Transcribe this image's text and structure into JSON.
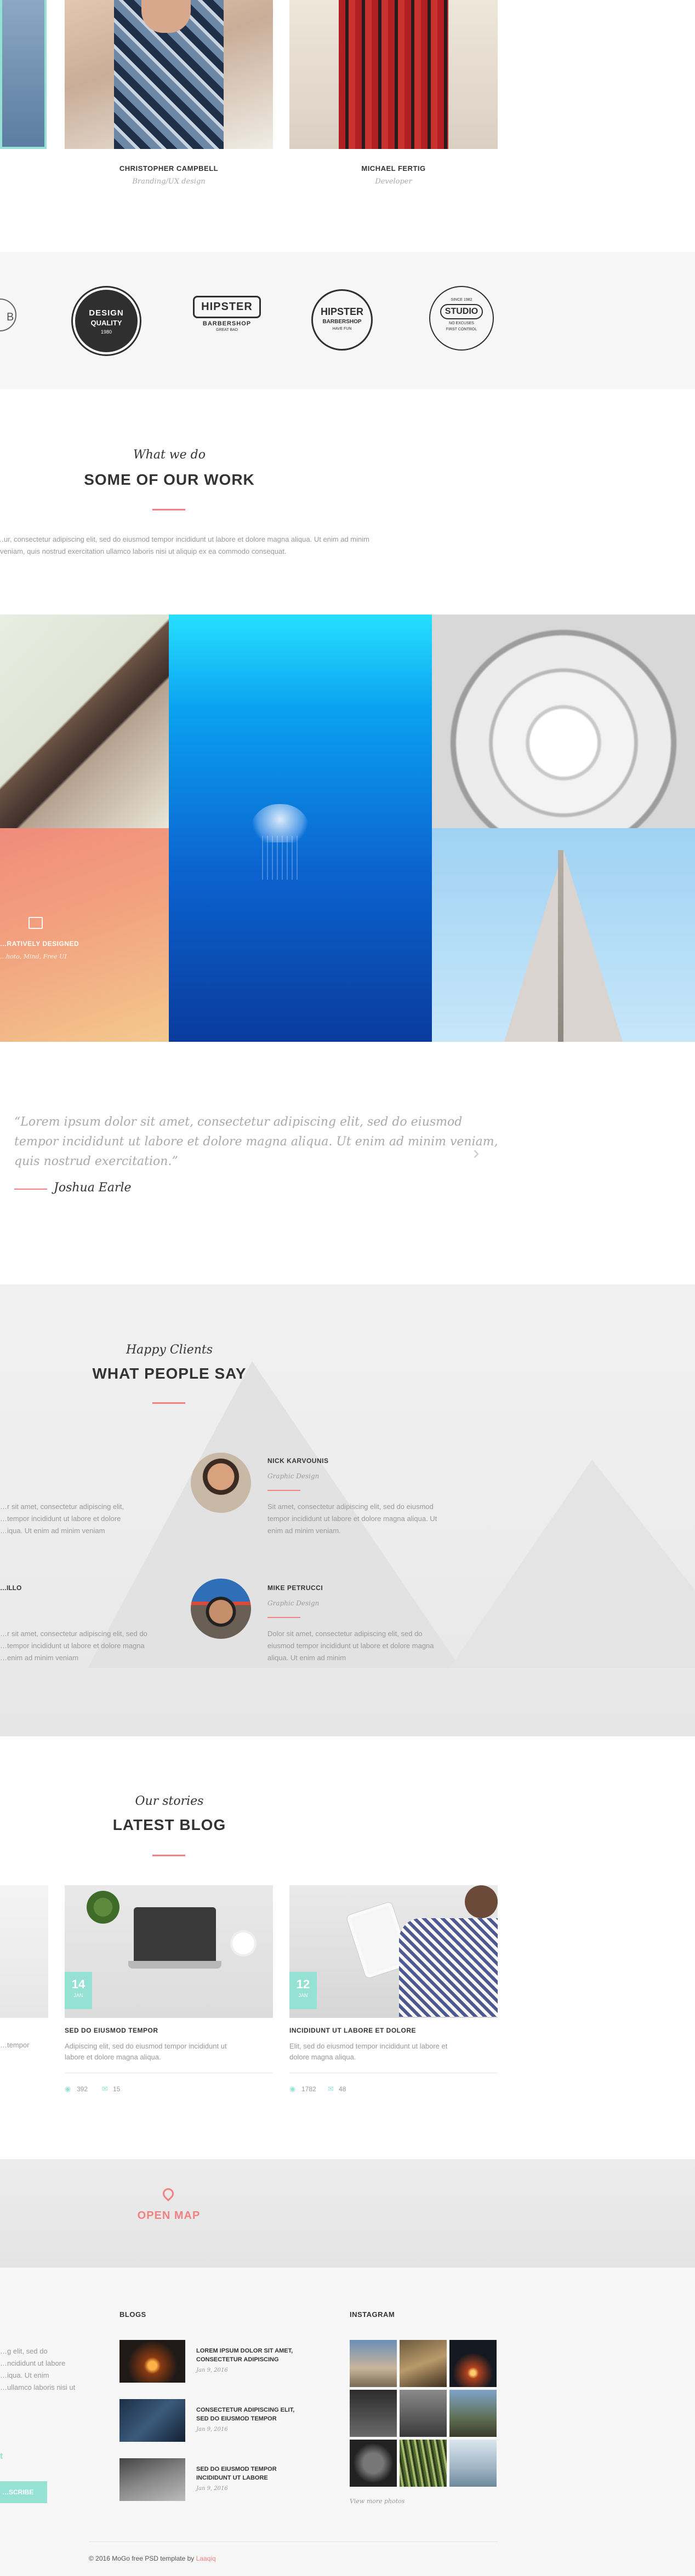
{
  "team": {
    "members": [
      {
        "name": "CHRISTOPHER CAMPBELL",
        "role": "Branding/UX design"
      },
      {
        "name": "MICHAEL FERTIG",
        "role": "Developer"
      }
    ]
  },
  "brands": {
    "logos": [
      {
        "lines": [
          "DESIGN",
          "QUALITY",
          "1980"
        ]
      },
      {
        "lines": [
          "HIPSTER",
          "BARBERSHOP",
          "GREAT BAD"
        ]
      },
      {
        "lines": [
          "HIPSTER",
          "BARBERSHOP",
          "HAVE FUN"
        ]
      },
      {
        "lines": [
          "STUDIO",
          "SINCE 1982",
          "NO EXCUSES",
          "FIRST CONTROL"
        ]
      }
    ]
  },
  "work": {
    "subtitle": "What we do",
    "title": "SOME OF OUR WORK",
    "text_line1": "…ur, consectetur adipiscing elit, sed do eiusmod tempor incididunt ut labore et dolore magna aliqua. Ut enim ad minim",
    "text_line2": "veniam, quis nostrud exercitation ullamco laboris nisi ut aliquip ex ea commodo consequat.",
    "overlay_title": "…RATIVELY DESIGNED",
    "overlay_sub": "…hoto, Mind, Free UI"
  },
  "quote": {
    "line1": "“Lorem ipsum dolor sit amet, consectetur adipiscing elit, sed do eiusmod",
    "line2": "tempor incididunt ut labore et dolore magna aliqua. Ut enim ad minim veniam,",
    "line3": "quis nostrud exercitation.”",
    "author": "Joshua Earle",
    "next": "›"
  },
  "clients": {
    "subtitle": "Happy Clients",
    "title": "WHAT PEOPLE SAY",
    "left_items": [
      {
        "text_lines": [
          "…r sit amet, consectetur adipiscing elit,",
          "…tempor incididunt ut labore et dolore",
          "…iqua. Ut enim ad minim veniam"
        ]
      },
      {
        "name": "…ILLO",
        "text_lines": [
          "…r sit amet, consectetur adipiscing elit, sed do",
          "…tempor incididunt ut labore et dolore magna",
          "…enim ad minim veniam"
        ]
      }
    ],
    "items": [
      {
        "name": "NICK KARVOUNIS",
        "role": "Graphic Design",
        "text_lines": [
          "Sit amet, consectetur adipiscing elit, sed do eiusmod",
          "tempor incididunt ut labore et dolore magna aliqua. Ut",
          "enim ad minim veniam."
        ]
      },
      {
        "name": "MIKE PETRUCCI",
        "role": "Graphic Design",
        "text_lines": [
          "Dolor sit amet, consectetur adipiscing elit, sed do",
          "eiusmod tempor incididunt ut labore et dolore magna",
          "aliqua. Ut enim ad minim"
        ]
      }
    ]
  },
  "blog": {
    "subtitle": "Our stories",
    "title": "LATEST BLOG",
    "left_excerpt": "…tempor",
    "posts": [
      {
        "day": "14",
        "month": "JAN",
        "title": "SED DO EIUSMOD TEMPOR",
        "excerpt_lines": [
          "Adipiscing elit, sed do eiusmod tempor incididunt ut",
          "labore et dolore magna aliqua."
        ],
        "views": "392",
        "comments": "15"
      },
      {
        "day": "12",
        "month": "JAN",
        "title": "INCIDIDUNT UT LABORE ET DOLORE",
        "excerpt_lines": [
          "Elit, sed do eiusmod tempor incididunt ut labore et",
          "dolore magna aliqua."
        ],
        "views": "1782",
        "comments": "48"
      }
    ]
  },
  "map": {
    "label": "OPEN MAP"
  },
  "footer": {
    "about_lines": [
      "…g elit, sed do",
      "…ncididunt ut labore",
      "…iqua. Ut enim",
      "…ullamco laboris nisi ut"
    ],
    "subscribe": "…SCRIBE",
    "blogs_heading": "BLOGS",
    "blog_items": [
      {
        "title_lines": [
          "LOREM IPSUM DOLOR SIT AMET,",
          "CONSECTETUR ADIPISCING"
        ],
        "date": "Jan 9, 2016"
      },
      {
        "title_lines": [
          "CONSECTETUR ADIPISCING ELIT,",
          "SED DO EIUSMOD TEMPOR"
        ],
        "date": "Jan 9, 2016"
      },
      {
        "title_lines": [
          "SED DO EIUSMOD TEMPOR",
          "INCIDIDUNT UT LABORE"
        ],
        "date": "Jan 9, 2016"
      }
    ],
    "instagram_heading": "INSTAGRAM",
    "view_more": "View more photos",
    "copyright": "© 2016 MoGo free PSD template by",
    "copyright_link": "Laaqiq"
  },
  "colors": {
    "accent": "#f38181",
    "teal": "#95e1d3",
    "light_bg": "#f7f7f7"
  }
}
